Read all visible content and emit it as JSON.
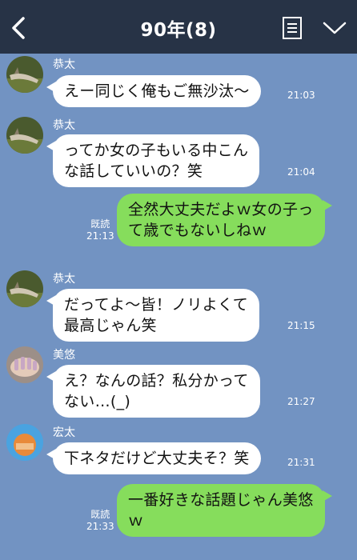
{
  "header": {
    "title": "90年(8)",
    "back_icon": "chevron-left-icon",
    "note_icon": "note-icon",
    "menu_icon": "chevron-down-icon"
  },
  "colors": {
    "header_bg": "#273346",
    "chat_bg": "#7293c2",
    "incoming_bubble": "#ffffff",
    "outgoing_bubble": "#86dd5c"
  },
  "messages": [
    {
      "sender": "恭太",
      "text": "えー同じく俺もご無沙汰〜",
      "time": "21:03"
    },
    {
      "sender": "恭太",
      "text": "ってか女の子もいる中こん\nな話していいの？笑",
      "time": "21:04"
    },
    {
      "read": "既読",
      "text": "全然大丈夫だよｗ女の子っ\nて歳でもないしねｗ",
      "time": "21:13"
    },
    {
      "sender": "恭太",
      "text": "だってよ〜皆！ノリよくて\n最高じゃん笑",
      "time": "21:15"
    },
    {
      "sender": "美悠",
      "text": "え？なんの話？私分かって\nない…(_)",
      "time": "21:27"
    },
    {
      "sender": "宏太",
      "text": "下ネタだけど大丈夫そ？笑",
      "time": "21:31"
    },
    {
      "read": "既読",
      "text": "一番好きな話題じゃん美悠\nｗ",
      "time": "21:33"
    }
  ]
}
